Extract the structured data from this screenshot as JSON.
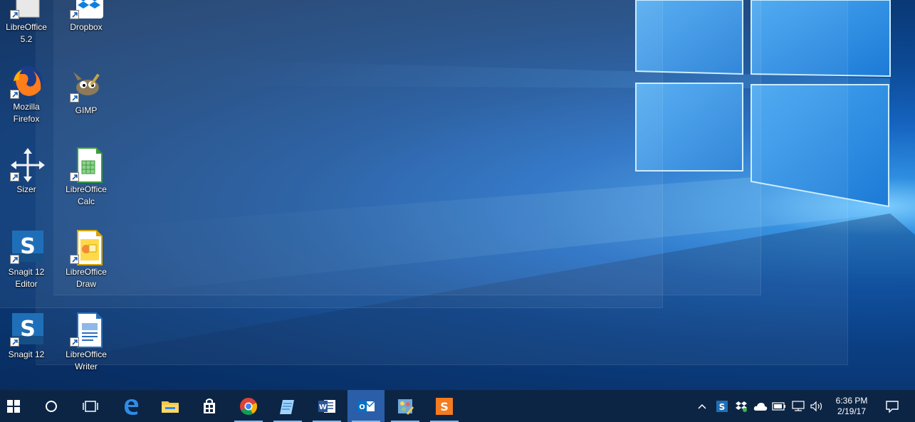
{
  "desktop": {
    "icons": [
      {
        "name": "libreoffice-icon",
        "label": "LibreOffice\n5.2"
      },
      {
        "name": "dropbox-icon",
        "label": "Dropbox"
      },
      {
        "name": "firefox-icon",
        "label": "Mozilla\nFirefox"
      },
      {
        "name": "gimp-icon",
        "label": "GIMP"
      },
      {
        "name": "sizer-icon",
        "label": "Sizer"
      },
      {
        "name": "libreoffice-calc-icon",
        "label": "LibreOffice\nCalc"
      },
      {
        "name": "snagit-editor-icon",
        "label": "Snagit 12\nEditor"
      },
      {
        "name": "libreoffice-draw-icon",
        "label": "LibreOffice\nDraw"
      },
      {
        "name": "snagit-icon",
        "label": "Snagit 12"
      },
      {
        "name": "libreoffice-writer-icon",
        "label": "LibreOffice\nWriter"
      }
    ]
  },
  "taskbar": {
    "buttons": [
      {
        "name": "start-button",
        "icon": "windows-logo-icon"
      },
      {
        "name": "cortana-search-button",
        "icon": "circle-icon"
      },
      {
        "name": "task-view-button",
        "icon": "task-view-icon"
      },
      {
        "name": "edge-button",
        "icon": "edge-icon"
      },
      {
        "name": "file-explorer-button",
        "icon": "folder-icon"
      },
      {
        "name": "store-button",
        "icon": "store-bag-icon"
      },
      {
        "name": "chrome-button",
        "icon": "chrome-icon"
      },
      {
        "name": "notepad-button",
        "icon": "notepad-icon"
      },
      {
        "name": "word-button",
        "icon": "word-icon"
      },
      {
        "name": "outlook-button",
        "icon": "outlook-icon"
      },
      {
        "name": "app-button",
        "icon": "paint-icon"
      },
      {
        "name": "snagit-capture-button",
        "icon": "snagit-capture-icon"
      }
    ],
    "tray": {
      "icons": [
        "chevron-up-icon",
        "snagit-tray-icon",
        "dropbox-tray-icon",
        "onedrive-cloud-icon",
        "battery-icon",
        "network-icon",
        "volume-icon"
      ],
      "time": "6:36 PM",
      "date": "2/19/17",
      "notifications_icon": "action-center-icon"
    }
  },
  "colors": {
    "taskbar": "#0d2545",
    "taskbar_active": "#2a5ea8",
    "accent": "#0078d7"
  }
}
